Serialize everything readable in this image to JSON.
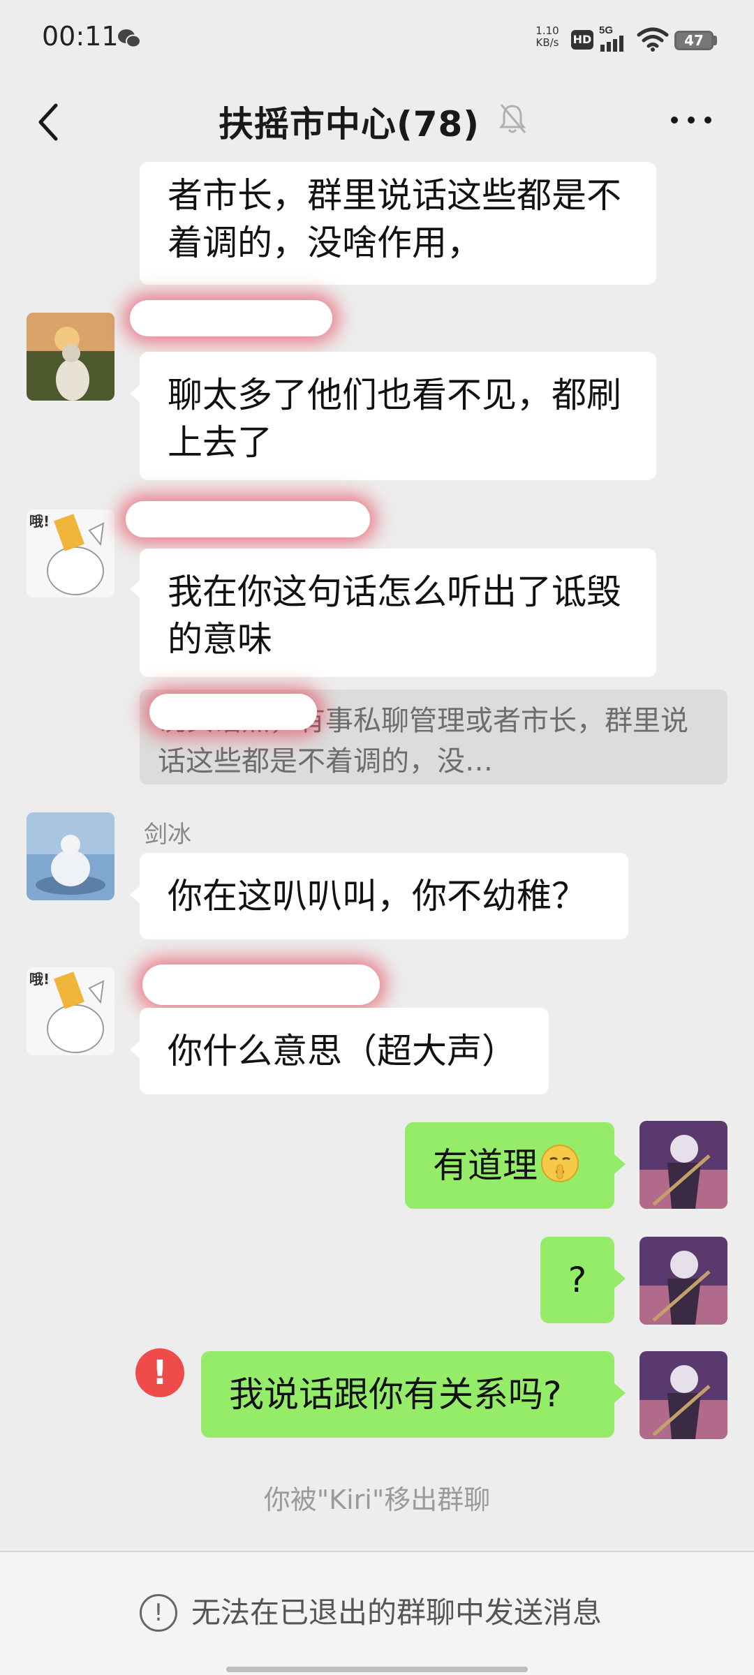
{
  "status_bar": {
    "time": "00:11",
    "net_speed_value": "1.10",
    "net_speed_unit": "KB/s",
    "hd_badge": "HD",
    "network": "5G",
    "battery": "47"
  },
  "header": {
    "title": "扶摇市中心(78)",
    "muted": true
  },
  "messages": [
    {
      "side": "left",
      "text": "者市长，群里说话这些都是不着调的，没啥作用，",
      "partial": true
    },
    {
      "side": "left",
      "avatar": "girl-field-avatar",
      "sender_redacted": true,
      "text": "聊太多了他们也看不见，都刷上去了"
    },
    {
      "side": "left",
      "avatar": "cat-sticker-avatar",
      "sender_redacted": true,
      "text": "我在你这句话怎么听出了诋毁的意味"
    },
    {
      "type": "quote",
      "text_visible": "说实话点，有事私聊管理或者市长，群里说话这些都是不着调的，没…"
    },
    {
      "side": "left",
      "avatar": "meditating-figure-avatar",
      "sender": "剑冰",
      "text": "你在这叭叭叫，你不幼稚？"
    },
    {
      "side": "left",
      "avatar": "cat-sticker-avatar",
      "sender_redacted": true,
      "text": "你什么意思（超大声）"
    },
    {
      "side": "right",
      "avatar": "anime-self-avatar",
      "text": "有道理",
      "emoji": "shushing-face-emoji"
    },
    {
      "side": "right",
      "avatar": "anime-self-avatar",
      "text": "?"
    },
    {
      "side": "right",
      "avatar": "anime-self-avatar",
      "text": "我说话跟你有关系吗?",
      "failed": true,
      "failed_mark": "!"
    }
  ],
  "system_notice": "你被\"Kiri\"移出群聊",
  "footer": {
    "icon_glyph": "!",
    "notice": "无法在已退出的群聊中发送消息"
  }
}
